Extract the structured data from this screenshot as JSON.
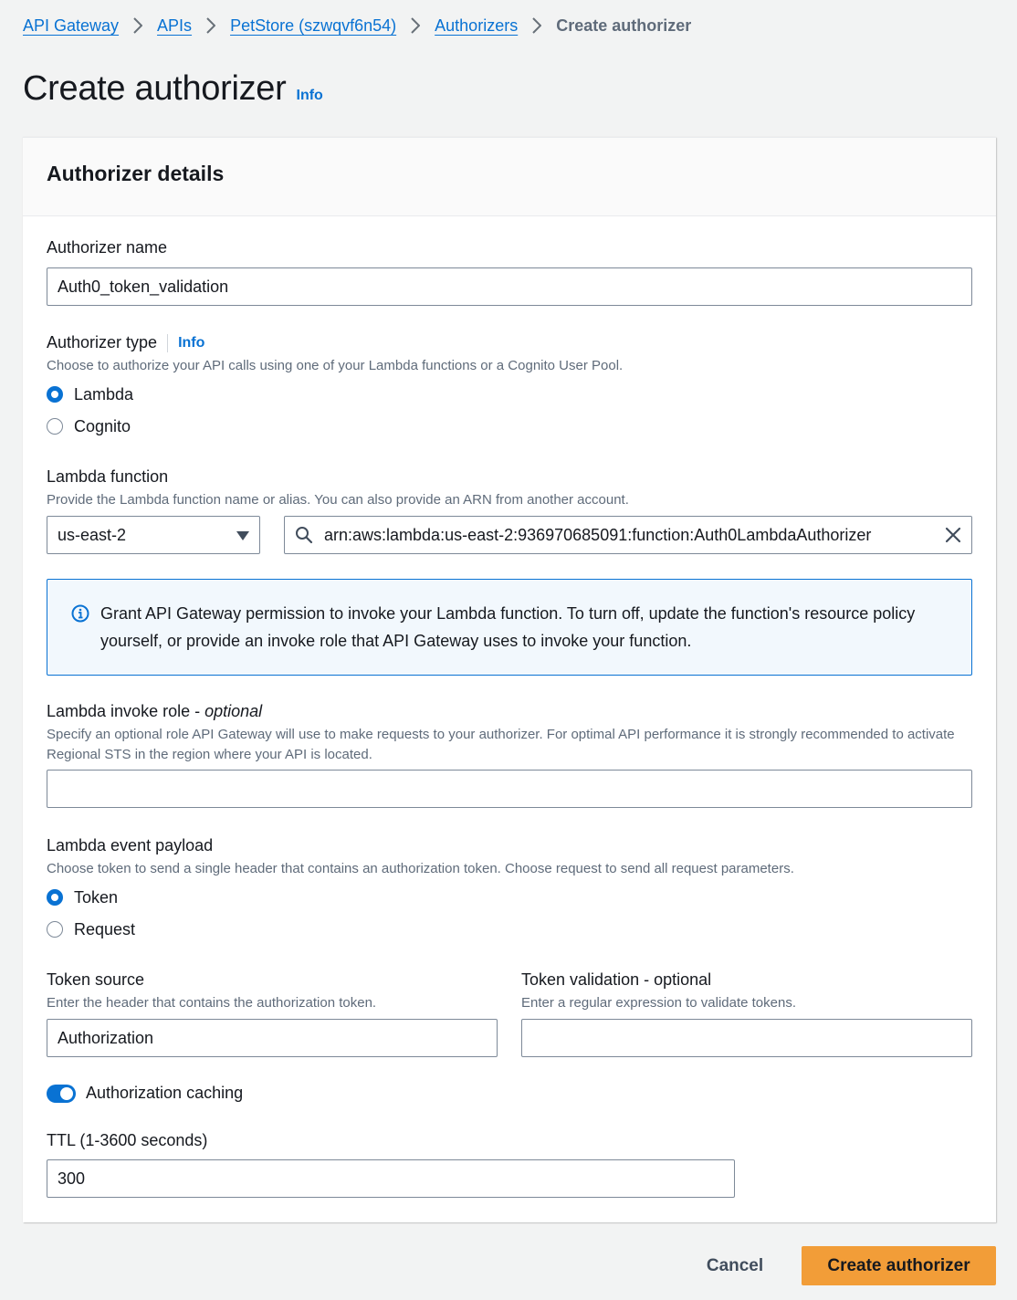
{
  "breadcrumb": {
    "items": [
      "API Gateway",
      "APIs",
      "PetStore (szwqvf6n54)",
      "Authorizers"
    ],
    "current": "Create authorizer"
  },
  "page": {
    "title": "Create authorizer",
    "info": "Info"
  },
  "card": {
    "title": "Authorizer details"
  },
  "authorizer_name": {
    "label": "Authorizer name",
    "value": "Auth0_token_validation"
  },
  "authorizer_type": {
    "label": "Authorizer type",
    "info": "Info",
    "description": "Choose to authorize your API calls using one of your Lambda functions or a Cognito User Pool.",
    "options": [
      "Lambda",
      "Cognito"
    ],
    "selected": "Lambda"
  },
  "lambda_function": {
    "label": "Lambda function",
    "description": "Provide the Lambda function name or alias. You can also provide an ARN from another account.",
    "region": "us-east-2",
    "value": "arn:aws:lambda:us-east-2:936970685091:function:Auth0LambdaAuthorizer"
  },
  "alert": {
    "text": "Grant API Gateway permission to invoke your Lambda function. To turn off, update the function's resource policy yourself, or provide an invoke role that API Gateway uses to invoke your function."
  },
  "invoke_role": {
    "label": "Lambda invoke role - ",
    "label_optional": "optional",
    "description": "Specify an optional role API Gateway will use to make requests to your authorizer. For optimal API performance it is strongly recommended to activate Regional STS in the region where your API is located.",
    "value": ""
  },
  "event_payload": {
    "label": "Lambda event payload",
    "description": "Choose token to send a single header that contains an authorization token. Choose request to send all request parameters.",
    "options": [
      "Token",
      "Request"
    ],
    "selected": "Token"
  },
  "token_source": {
    "label": "Token source",
    "description": "Enter the header that contains the authorization token.",
    "value": "Authorization"
  },
  "token_validation": {
    "label": "Token validation - optional",
    "description": "Enter a regular expression to validate tokens.",
    "value": ""
  },
  "caching": {
    "label": "Authorization caching",
    "enabled": true
  },
  "ttl": {
    "label": "TTL (1-3600 seconds)",
    "value": "300"
  },
  "actions": {
    "cancel": "Cancel",
    "submit": "Create authorizer"
  },
  "colors": {
    "accent": "#0972d3",
    "primary_button": "#f29d38"
  }
}
